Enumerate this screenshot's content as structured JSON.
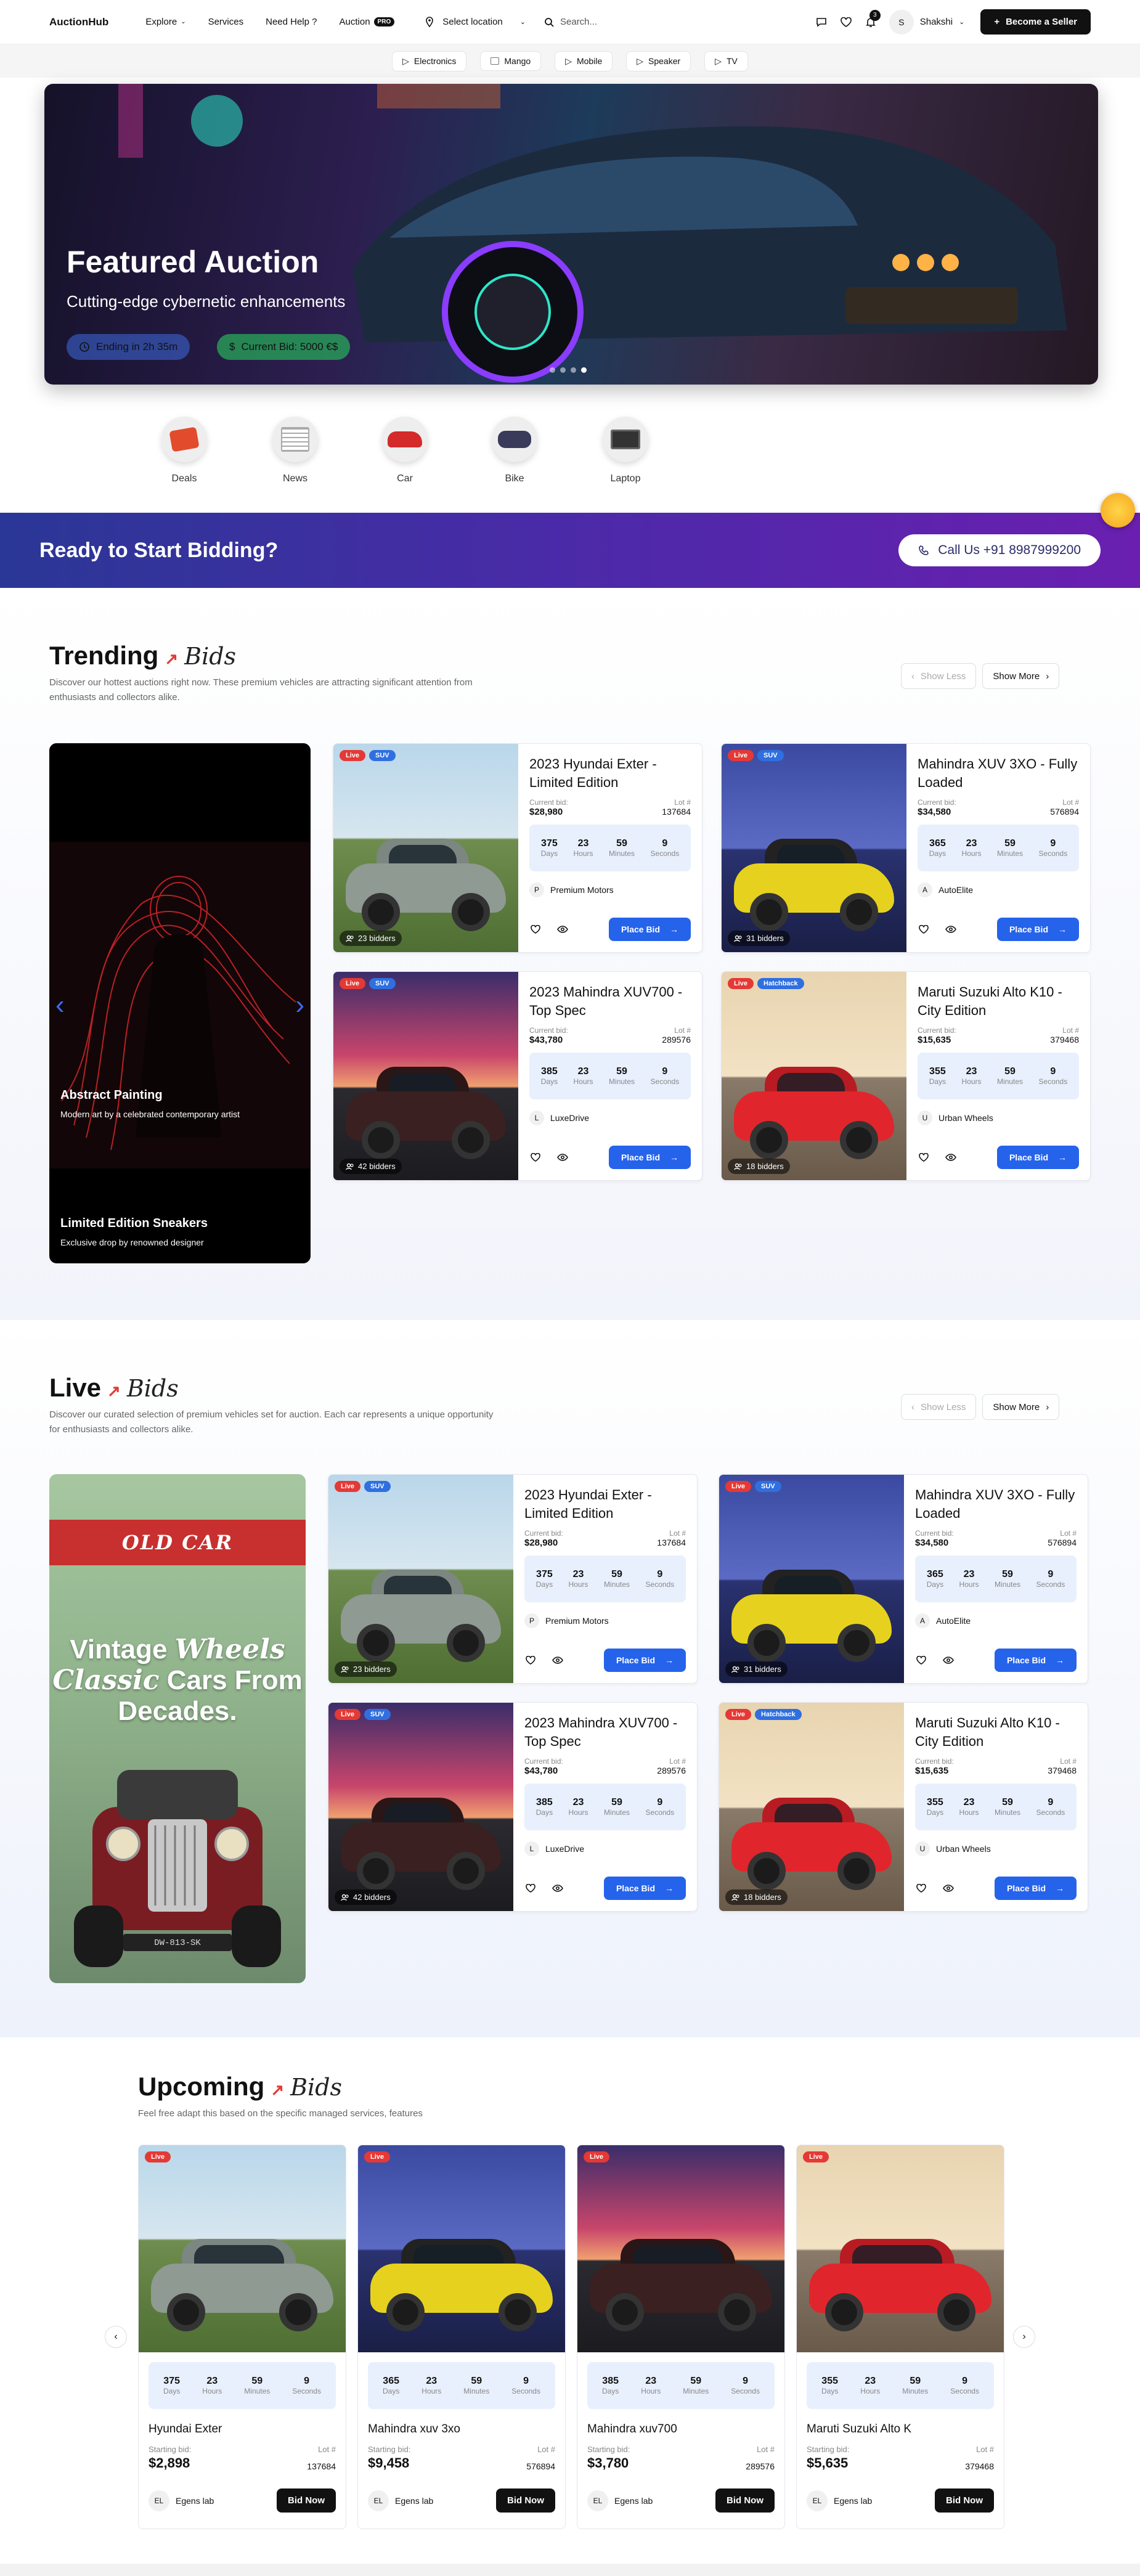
{
  "header": {
    "logo": "AuctionHub",
    "nav": [
      {
        "label": "Explore",
        "has_caret": true
      },
      {
        "label": "Services"
      },
      {
        "label": "Need Help ?"
      },
      {
        "label": "Auction",
        "badge": "PRO"
      }
    ],
    "location": "Select location",
    "search_placeholder": "Search...",
    "notification_count": "3",
    "user_initial": "S",
    "user_name": "Shakshi",
    "cta": "Become a Seller"
  },
  "chips": [
    "Electronics",
    "Mango",
    "Mobile",
    "Speaker",
    "TV"
  ],
  "hero": {
    "title": "Featured Auction",
    "subtitle": "Cutting-edge cybernetic enhancements",
    "ending": "Ending in 2h 35m",
    "current_bid": "Current Bid: 5000 €$"
  },
  "categories": [
    "Deals",
    "News",
    "Car",
    "Bike",
    "Laptop"
  ],
  "banner": {
    "title": "Ready to Start Bidding?",
    "call": "Call Us +91 8987999200"
  },
  "trending": {
    "title": "Trending",
    "title_italic": "Bids",
    "description": "Discover our hottest auctions right now. These premium vehicles are attracting significant attention from enthusiasts and collectors alike.",
    "show_less": "Show Less",
    "show_more": "Show More",
    "slider": [
      {
        "title": "Abstract Painting",
        "subtitle": "Modern art by a celebrated contemporary artist"
      },
      {
        "title": "Limited Edition Sneakers",
        "subtitle": "Exclusive drop by renowned designer"
      }
    ]
  },
  "live": {
    "title": "Live",
    "title_italic": "Bids",
    "description": "Discover our curated selection of premium vehicles set for auction. Each car represents a unique opportunity for enthusiasts and collectors alike.",
    "show_less": "Show Less",
    "show_more": "Show More",
    "poster": {
      "ribbon": "OLD CAR",
      "line1": "Vintage",
      "line1_italic": "Wheels",
      "line2_italic": "Classic",
      "line2": "Cars From",
      "line3": "Decades.",
      "plate": "DW-813-SK"
    }
  },
  "auction_cards": [
    {
      "live": "Live",
      "type": "SUV",
      "title": "2023 Hyundai Exter - Limited Edition",
      "bid_label": "Current bid:",
      "bid": "$28,980",
      "lot_label": "Lot #",
      "lot": "137684",
      "timer": [
        "375",
        "23",
        "59",
        "9"
      ],
      "seller_initial": "P",
      "seller": "Premium Motors",
      "bidders": "23 bidders",
      "button": "Place Bid"
    },
    {
      "live": "Live",
      "type": "SUV",
      "title": "Mahindra XUV 3XO - Fully Loaded",
      "bid_label": "Current bid:",
      "bid": "$34,580",
      "lot_label": "Lot #",
      "lot": "576894",
      "timer": [
        "365",
        "23",
        "59",
        "9"
      ],
      "seller_initial": "A",
      "seller": "AutoElite",
      "bidders": "31 bidders",
      "button": "Place Bid"
    },
    {
      "live": "Live",
      "type": "SUV",
      "title": "2023 Mahindra XUV700 - Top Spec",
      "bid_label": "Current bid:",
      "bid": "$43,780",
      "lot_label": "Lot #",
      "lot": "289576",
      "timer": [
        "385",
        "23",
        "59",
        "9"
      ],
      "seller_initial": "L",
      "seller": "LuxeDrive",
      "bidders": "42 bidders",
      "button": "Place Bid"
    },
    {
      "live": "Live",
      "type": "Hatchback",
      "title": "Maruti Suzuki Alto K10 - City Edition",
      "bid_label": "Current bid:",
      "bid": "$15,635",
      "lot_label": "Lot #",
      "lot": "379468",
      "timer": [
        "355",
        "23",
        "59",
        "9"
      ],
      "seller_initial": "U",
      "seller": "Urban Wheels",
      "bidders": "18 bidders",
      "button": "Place Bid"
    }
  ],
  "timer_labels": [
    "Days",
    "Hours",
    "Minutes",
    "Seconds"
  ],
  "upcoming": {
    "title": "Upcoming",
    "title_italic": "Bids",
    "description": "Feel free adapt this based on the specific managed services, features",
    "cards": [
      {
        "live": "Live",
        "title": "Hyundai Exter",
        "bid_label": "Starting bid:",
        "bid": "$2,898",
        "lot_label": "Lot #",
        "lot": "137684",
        "timer": [
          "375",
          "23",
          "59",
          "9"
        ],
        "seller_initial": "EL",
        "seller": "Egens lab",
        "button": "Bid Now"
      },
      {
        "live": "Live",
        "title": "Mahindra xuv 3xo",
        "bid_label": "Starting bid:",
        "bid": "$9,458",
        "lot_label": "Lot #",
        "lot": "576894",
        "timer": [
          "365",
          "23",
          "59",
          "9"
        ],
        "seller_initial": "EL",
        "seller": "Egens lab",
        "button": "Bid Now"
      },
      {
        "live": "Live",
        "title": "Mahindra xuv700",
        "bid_label": "Starting bid:",
        "bid": "$3,780",
        "lot_label": "Lot #",
        "lot": "289576",
        "timer": [
          "385",
          "23",
          "59",
          "9"
        ],
        "seller_initial": "EL",
        "seller": "Egens lab",
        "button": "Bid Now"
      },
      {
        "live": "Live",
        "title": "Maruti Suzuki Alto K",
        "bid_label": "Starting bid:",
        "bid": "$5,635",
        "lot_label": "Lot #",
        "lot": "379468",
        "timer": [
          "355",
          "23",
          "59",
          "9"
        ],
        "seller_initial": "EL",
        "seller": "Egens lab",
        "button": "Bid Now"
      }
    ]
  },
  "colors": {
    "accent": "#2563eb",
    "live": "#e53935",
    "banner_start": "#2a3796",
    "banner_end": "#6a1fb0",
    "timer_bg": "#e8f0fd"
  }
}
